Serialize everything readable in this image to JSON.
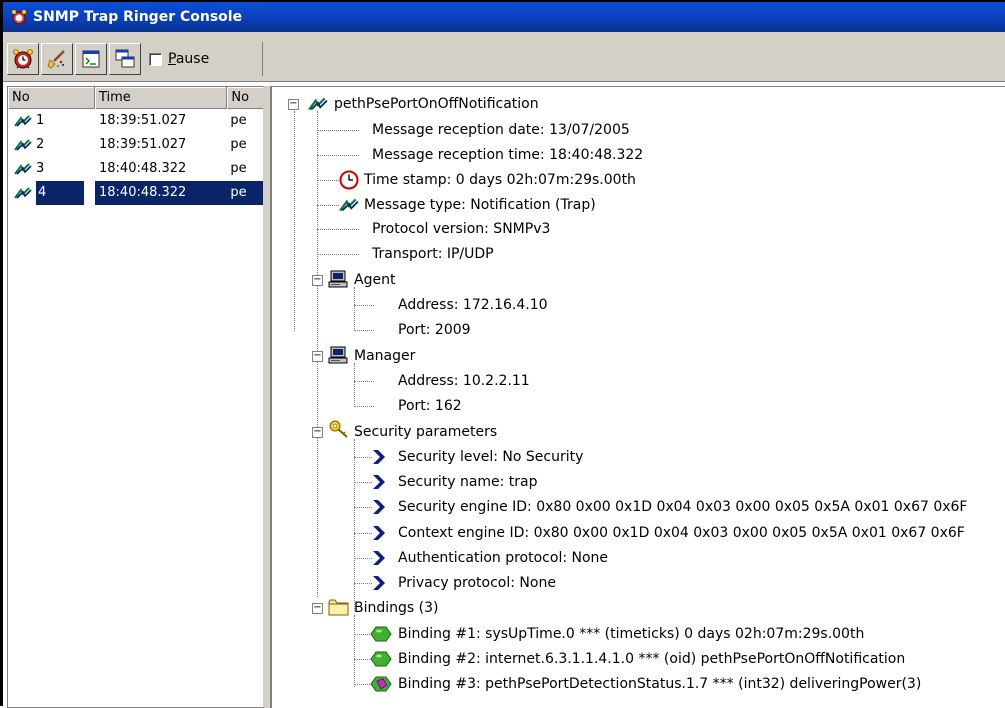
{
  "window": {
    "title": "SNMP Trap Ringer Console"
  },
  "toolbar": {
    "buttons": [
      "alarm-clock-icon",
      "clear-icon",
      "config-icon",
      "window-icon"
    ],
    "pause_label": "Pause",
    "pause_checked": false
  },
  "list": {
    "columns": [
      "No",
      "Time",
      "No"
    ],
    "rows": [
      {
        "no": "1",
        "time": "18:39:51.027",
        "notif": "pe"
      },
      {
        "no": "2",
        "time": "18:39:51.027",
        "notif": "pe"
      },
      {
        "no": "3",
        "time": "18:40:48.322",
        "notif": "pe"
      },
      {
        "no": "4",
        "time": "18:40:48.322",
        "notif": "pe"
      }
    ],
    "selected_index": 3
  },
  "tree": {
    "root": "pethPsePortOnOffNotification",
    "reception_date": "Message reception date: 13/07/2005",
    "reception_time": "Message reception time: 18:40:48.322",
    "timestamp": "Time stamp: 0 days 02h:07m:29s.00th",
    "message_type": "Message type: Notification (Trap)",
    "protocol_version": "Protocol version: SNMPv3",
    "transport": "Transport: IP/UDP",
    "agent": {
      "label": "Agent",
      "address": "Address: 172.16.4.10",
      "port": "Port: 2009"
    },
    "manager": {
      "label": "Manager",
      "address": "Address: 10.2.2.11",
      "port": "Port: 162"
    },
    "security": {
      "label": "Security parameters",
      "level": "Security level: No Security",
      "name": "Security name: trap",
      "engine_id": "Security engine ID: 0x80 0x00 0x1D 0x04 0x03 0x00 0x05 0x5A 0x01 0x67 0x6F",
      "context_engine_id": "Context engine ID: 0x80 0x00 0x1D 0x04 0x03 0x00 0x05 0x5A 0x01 0x67 0x6F",
      "auth": "Authentication protocol: None",
      "privacy": "Privacy protocol: None"
    },
    "bindings": {
      "label": "Bindings (3)",
      "b1": "Binding #1: sysUpTime.0 *** (timeticks) 0 days 02h:07m:29s.00th",
      "b2": "Binding #2: internet.6.3.1.1.4.1.0 *** (oid) pethPsePortOnOffNotification",
      "b3": "Binding #3: pethPsePortDetectionStatus.1.7 *** (int32) deliveringPower(3)"
    }
  },
  "colors": {
    "titlebar": "#0a3fb8",
    "selection": "#0a246a",
    "chrome": "#d4d0c8"
  }
}
